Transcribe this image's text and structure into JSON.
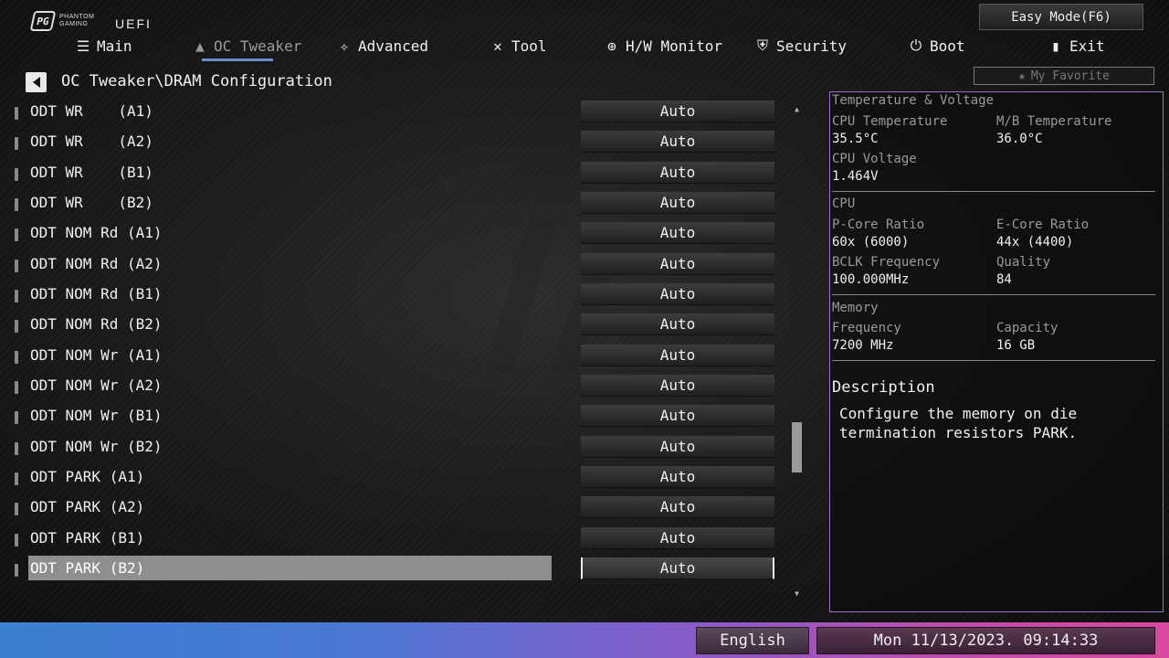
{
  "header": {
    "logo_line1": "PHANTOM",
    "logo_line2": "GAMING",
    "uefi": "UEFI",
    "easy_mode": "Easy Mode(F6)",
    "my_favorite": "My Favorite"
  },
  "nav": {
    "items": [
      {
        "label": "Main",
        "icon": "list-icon"
      },
      {
        "label": "OC Tweaker",
        "icon": "rocket-icon",
        "active": true
      },
      {
        "label": "Advanced",
        "icon": "star-icon"
      },
      {
        "label": "Tool",
        "icon": "tools-icon"
      },
      {
        "label": "H/W Monitor",
        "icon": "monitor-icon"
      },
      {
        "label": "Security",
        "icon": "shield-icon"
      },
      {
        "label": "Boot",
        "icon": "power-icon"
      },
      {
        "label": "Exit",
        "icon": "exit-door-icon"
      }
    ]
  },
  "breadcrumb": "OC Tweaker\\DRAM Configuration",
  "settings": [
    {
      "label": "ODT WR    (A1)",
      "value": "Auto"
    },
    {
      "label": "ODT WR    (A2)",
      "value": "Auto"
    },
    {
      "label": "ODT WR    (B1)",
      "value": "Auto"
    },
    {
      "label": "ODT WR    (B2)",
      "value": "Auto"
    },
    {
      "label": "ODT NOM Rd (A1)",
      "value": "Auto"
    },
    {
      "label": "ODT NOM Rd (A2)",
      "value": "Auto"
    },
    {
      "label": "ODT NOM Rd (B1)",
      "value": "Auto"
    },
    {
      "label": "ODT NOM Rd (B2)",
      "value": "Auto"
    },
    {
      "label": "ODT NOM Wr (A1)",
      "value": "Auto"
    },
    {
      "label": "ODT NOM Wr (A2)",
      "value": "Auto"
    },
    {
      "label": "ODT NOM Wr (B1)",
      "value": "Auto"
    },
    {
      "label": "ODT NOM Wr (B2)",
      "value": "Auto"
    },
    {
      "label": "ODT PARK (A1)",
      "value": "Auto"
    },
    {
      "label": "ODT PARK (A2)",
      "value": "Auto"
    },
    {
      "label": "ODT PARK (B1)",
      "value": "Auto"
    },
    {
      "label": "ODT PARK (B2)",
      "value": "Auto",
      "selected": true
    }
  ],
  "panel": {
    "temp_header": "Temperature & Voltage",
    "cpu_temp_label": "CPU Temperature",
    "cpu_temp": "35.5°C",
    "mb_temp_label": "M/B Temperature",
    "mb_temp": "36.0°C",
    "cpu_volt_label": "CPU Voltage",
    "cpu_volt": "1.464V",
    "cpu_header": "CPU",
    "pcore_label": "P-Core Ratio",
    "pcore": "60x (6000)",
    "ecore_label": "E-Core Ratio",
    "ecore": "44x (4400)",
    "bclk_label": "BCLK Frequency",
    "bclk": "100.000MHz",
    "quality_label": "Quality",
    "quality": "84",
    "mem_header": "Memory",
    "freq_label": "Frequency",
    "freq": "7200 MHz",
    "cap_label": "Capacity",
    "cap": "16 GB",
    "desc_title": "Description",
    "desc_text": "Configure the memory on die termination resistors PARK."
  },
  "footer": {
    "language": "English",
    "datetime": "Mon 11/13/2023. 09:14:33"
  },
  "colors": {
    "accent_underline": "#6b8ccc",
    "panel_border": "#9a6fd0",
    "selected_row": "#8e8e8e"
  }
}
